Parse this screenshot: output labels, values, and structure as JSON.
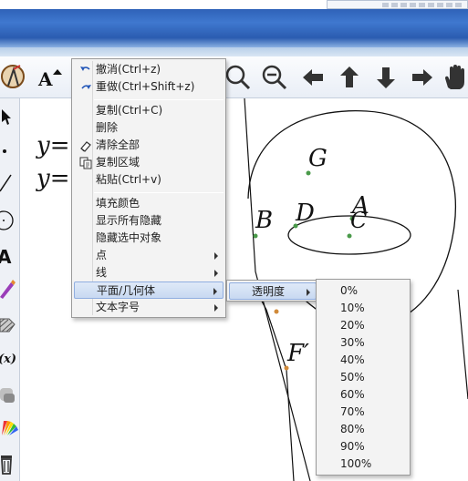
{
  "context_menu": {
    "items": [
      {
        "label": "撤消(Ctrl+z)",
        "icon": "undo-icon"
      },
      {
        "label": "重做(Ctrl+Shift+z)",
        "icon": "redo-icon"
      },
      {
        "label": "复制(Ctrl+C)"
      },
      {
        "label": "删除"
      },
      {
        "label": "清除全部",
        "icon": "eraser-icon"
      },
      {
        "label": "复制区域",
        "icon": "copy-region-icon"
      },
      {
        "label": "粘贴(Ctrl+v)"
      },
      {
        "label": "填充颜色"
      },
      {
        "label": "显示所有隐藏"
      },
      {
        "label": "隐藏选中对象"
      },
      {
        "label": "点",
        "submenu": true
      },
      {
        "label": "线",
        "submenu": true
      },
      {
        "label": "平面/几何体",
        "submenu": true,
        "highlighted": true
      },
      {
        "label": "文本字号",
        "submenu": true
      }
    ]
  },
  "plane_submenu": {
    "items": [
      {
        "label": "透明度",
        "submenu": true,
        "highlighted": true
      }
    ]
  },
  "opacity_submenu": {
    "options": [
      "0%",
      "10%",
      "20%",
      "30%",
      "40%",
      "50%",
      "60%",
      "70%",
      "80%",
      "90%",
      "100%"
    ]
  },
  "toolbar": {
    "icons": [
      "compass-icon",
      "text-size-icon",
      "zoom-in-icon",
      "zoom-out-icon",
      "arrow-left-icon",
      "arrow-up-icon",
      "arrow-down-icon",
      "arrow-right-icon",
      "hand-pan-icon"
    ]
  },
  "leftbar": {
    "icons": [
      "select-arrow-icon",
      "point-icon",
      "line-tool-icon",
      "circle-tool-icon",
      "text-tool-icon",
      "pen-icon",
      "fill-hatch-icon",
      "function-icon",
      "shade-icon",
      "palette-icon",
      "trash-icon"
    ]
  },
  "canvas": {
    "labels": {
      "G": "G",
      "D": "D",
      "A": "A",
      "C": "C",
      "B": "B",
      "F_prime": "F′",
      "y1": "y=",
      "y2": "y="
    },
    "point_color": "#4a9a4a",
    "orange_point_color": "#d08a3a"
  },
  "colors": {
    "title_bar": "#2f62b8",
    "menu_bg": "#f3f3f3",
    "highlight": "#c8d9f1"
  }
}
